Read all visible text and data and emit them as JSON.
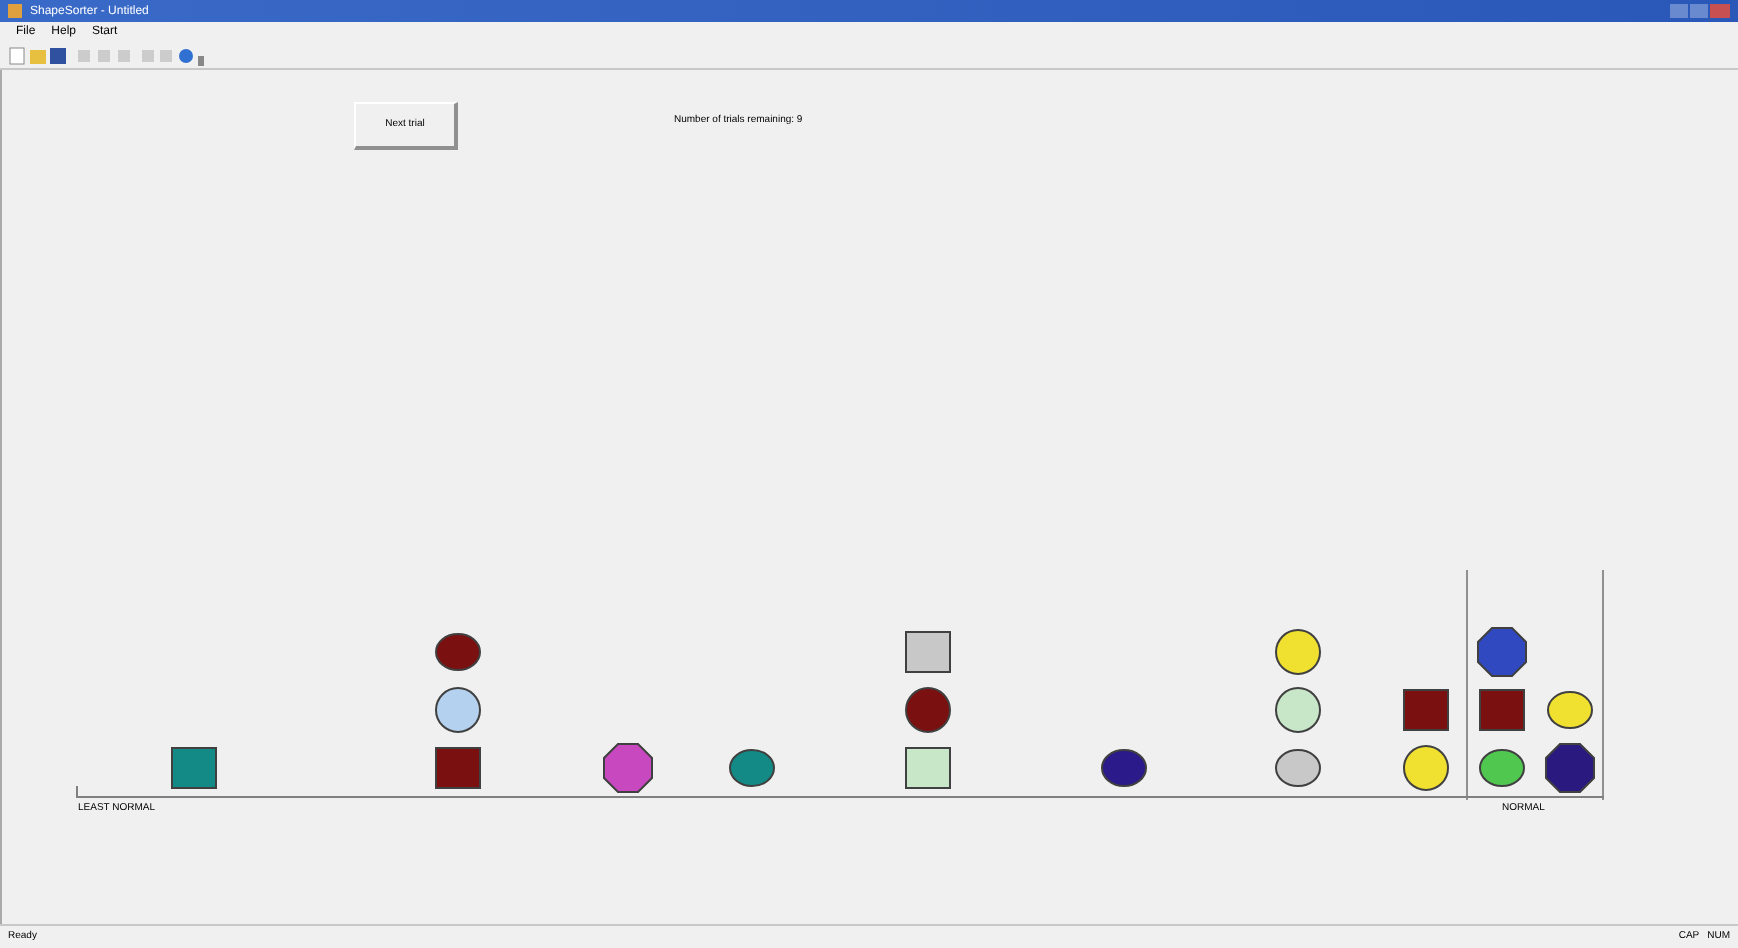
{
  "window": {
    "title": "ShapeSorter - Untitled"
  },
  "menu": [
    "File",
    "Help",
    "Start"
  ],
  "next_trial_button": "Next trial",
  "trials_remaining": "Number of trials remaining: 9",
  "scale": {
    "left_label": "LEAST NORMAL",
    "right_label": "NORMAL"
  },
  "stacks": [
    {
      "shapes": [
        {
          "kind": "square",
          "color": "#138a85"
        }
      ]
    },
    {
      "shapes": [
        {
          "kind": "square",
          "color": "#7a1010"
        },
        {
          "kind": "circle",
          "color": "#b4d2f0"
        },
        {
          "kind": "ellipse",
          "color": "#7a1010"
        }
      ]
    },
    {
      "shapes": [
        {
          "kind": "octagon",
          "color": "#c848c0"
        }
      ]
    },
    {
      "shapes": [
        {
          "kind": "ellipse",
          "color": "#138a85"
        }
      ]
    },
    {
      "shapes": [
        {
          "kind": "square",
          "color": "#c8e6c8"
        },
        {
          "kind": "circle",
          "color": "#7a1010"
        },
        {
          "kind": "square",
          "color": "#c8c8c8"
        }
      ]
    },
    {
      "shapes": [
        {
          "kind": "ellipse",
          "color": "#2a1a8a"
        }
      ]
    },
    {
      "shapes": [
        {
          "kind": "ellipse",
          "color": "#c8c8c8"
        },
        {
          "kind": "circle",
          "color": "#c8e6c8"
        },
        {
          "kind": "circle",
          "color": "#f0e030"
        }
      ]
    },
    {
      "shapes": [
        {
          "kind": "circle",
          "color": "#f0e030"
        },
        {
          "kind": "square",
          "color": "#7a1010"
        }
      ]
    }
  ],
  "normal_stacks": [
    {
      "shapes": [
        {
          "kind": "ellipse",
          "color": "#50c850"
        },
        {
          "kind": "square",
          "color": "#7a1010"
        },
        {
          "kind": "octagon",
          "color": "#3048c0"
        }
      ]
    },
    {
      "shapes": [
        {
          "kind": "octagon",
          "color": "#2a1a80"
        },
        {
          "kind": "ellipse",
          "color": "#f0e030"
        }
      ]
    }
  ],
  "status_bar": {
    "text": "Ready",
    "indicators": [
      "CAP",
      "NUM"
    ]
  }
}
